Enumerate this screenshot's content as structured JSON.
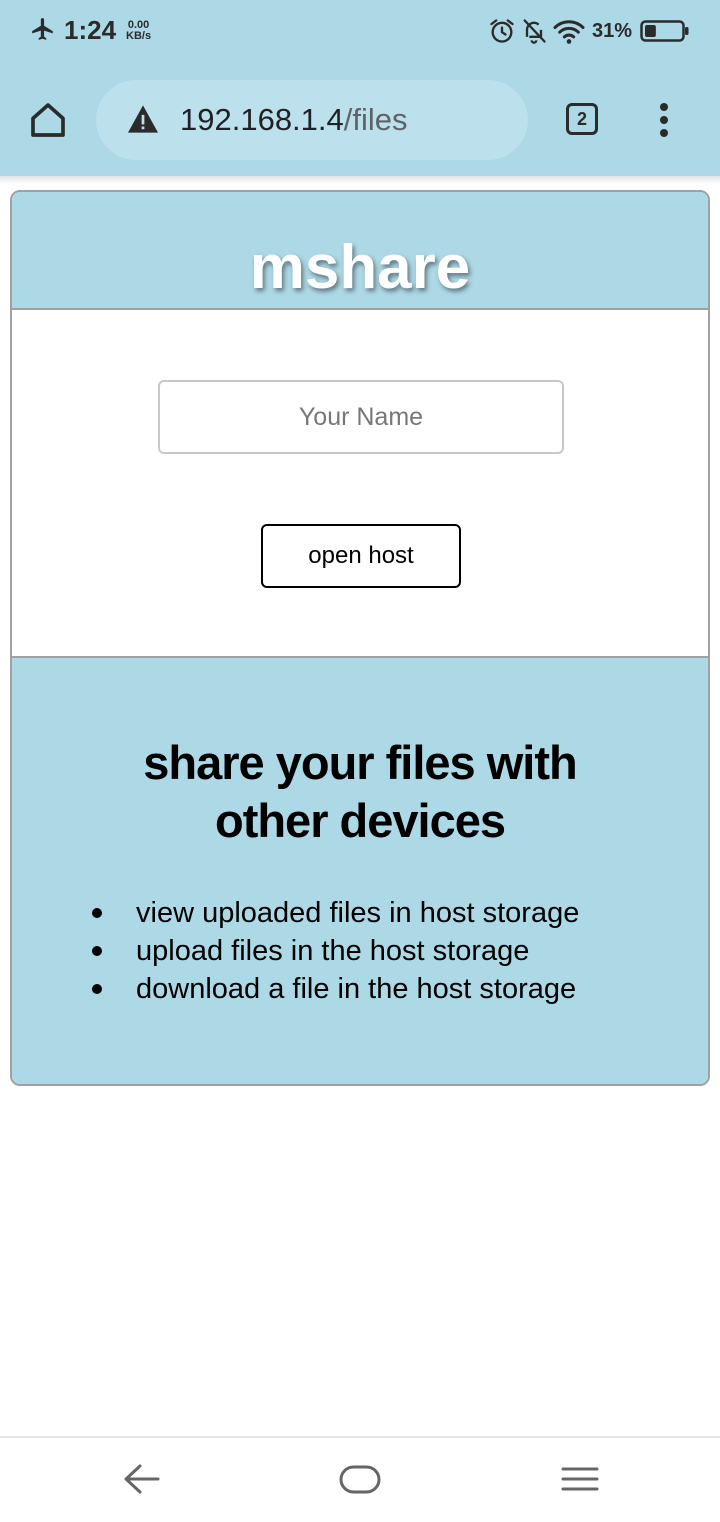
{
  "status_bar": {
    "time": "1:24",
    "net_speed_value": "0.00",
    "net_speed_unit": "KB/s",
    "battery_percent": "31%",
    "battery_level": 0.31,
    "icons": [
      "airplane-icon",
      "alarm-icon",
      "bell-off-icon",
      "wifi-icon",
      "battery-icon"
    ]
  },
  "browser": {
    "url_host": "192.168.1.4",
    "url_path": "/files",
    "tab_count": "2",
    "security_icon": "warning-triangle-icon"
  },
  "page": {
    "brand": "mshare",
    "name_input": {
      "placeholder": "Your Name",
      "value": ""
    },
    "open_host_label": "open host",
    "info": {
      "title_line1": "share your files with",
      "title_line2": "other devices",
      "features": [
        "view uploaded files in host storage",
        "upload files in the host storage",
        "download a file in the host storage"
      ]
    }
  },
  "colors": {
    "accent": "#add8e6",
    "card_border": "#a0a0a0",
    "text": "#000000"
  },
  "nav_bar": {
    "icons": [
      "back-icon",
      "home-nav-icon",
      "recents-icon"
    ]
  }
}
